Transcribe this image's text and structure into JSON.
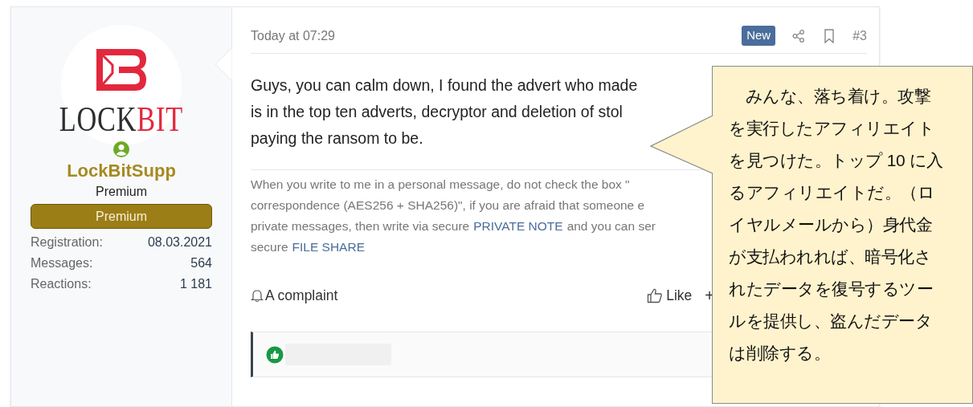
{
  "user": {
    "logo_words": [
      {
        "text": "LOCK",
        "color": "#2e2e2e"
      },
      {
        "text": "BIT",
        "color": "#e3283d"
      }
    ],
    "online": true,
    "username": "LockBitSupp",
    "user_title": "Premium",
    "banner": "Premium",
    "stats": [
      {
        "label": "Registration:",
        "value": "08.03.2021"
      },
      {
        "label": "Messages:",
        "value": "564"
      },
      {
        "label": "Reactions:",
        "value": "1 181"
      }
    ]
  },
  "post": {
    "time": "Today at 07:29",
    "badge": "New",
    "number": "#3",
    "body_lines": [
      "Guys, you can calm down, I found the advert who made",
      "is in the top ten adverts, decryptor and deletion of stol",
      "paying the ransom to be."
    ],
    "signature_lines": [
      [
        {
          "text": "When you write to me in a personal message, do not check the box \"",
          "link": false
        }
      ],
      [
        {
          "text": "correspondence (AES256 + SHA256)\", if you are afraid that someone e",
          "link": false
        }
      ],
      [
        {
          "text": "private messages, then write via secure",
          "link": false
        },
        {
          "text": "PRIVATE NOTE",
          "link": true
        },
        {
          "text": "and you can ser",
          "link": false
        }
      ],
      [
        {
          "text": "secure",
          "link": false
        },
        {
          "text": "FILE SHARE",
          "link": true
        }
      ]
    ],
    "actions": {
      "complaint": "A complaint",
      "like": "Like",
      "more": "+"
    }
  },
  "callout": {
    "text": "　みんな、落ち着け。攻撃を実行したアフィリエイトを見つけた。トップ 10 に入るアフィリエイトだ。（ロイヤルメールから）身代金が支払われれば、暗号化されたデータを復号するツールを提供し、盗んだデータは削除する。"
  }
}
